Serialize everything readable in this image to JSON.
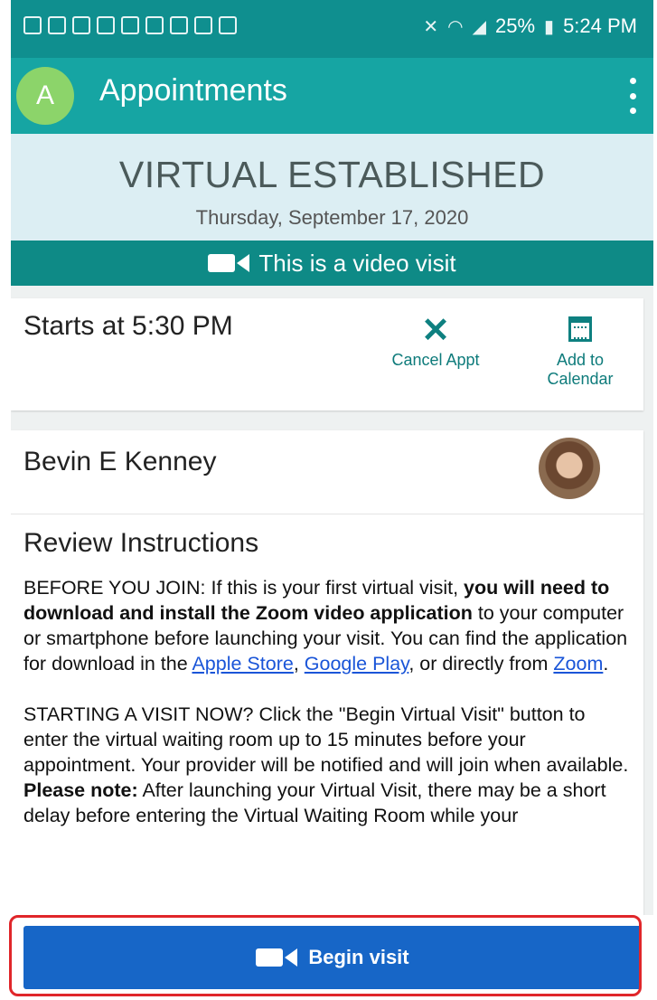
{
  "status_bar": {
    "battery": "25%",
    "time": "5:24 PM"
  },
  "app_bar": {
    "avatar_initial": "A",
    "title": "Appointments",
    "menu_icon": "kebab-menu-icon"
  },
  "visit": {
    "type": "VIRTUAL ESTABLISHED",
    "date": "Thursday, September 17, 2020",
    "video_banner": "This is a video visit"
  },
  "time_card": {
    "starts": "Starts at 5:30 PM",
    "cancel_label": "Cancel Appt",
    "calendar_label_line1": "Add to",
    "calendar_label_line2": "Calendar"
  },
  "provider": {
    "name": "Bevin E Kenney"
  },
  "instructions": {
    "heading": "Review Instructions",
    "p1_start": "BEFORE YOU JOIN: If this is your first virtual visit, ",
    "p1_bold": "you will need to download and install the Zoom video application",
    "p1_mid": " to your computer or smartphone before launching your visit. You can find the application for download in the ",
    "link_apple": "Apple Store",
    "sep1": ", ",
    "link_google": "Google Play",
    "sep2": ", or directly from ",
    "link_zoom": "Zoom",
    "p1_end": ".",
    "p2_start": "STARTING A VISIT NOW? Click the \"Begin Virtual Visit\" button to enter the virtual waiting room up to 15 minutes before your appointment. Your provider will be notified and will join when available. ",
    "p2_bold": "Please note:",
    "p2_end": " After launching your Virtual Visit, there may be a short delay before entering the Virtual Waiting Room while your"
  },
  "begin_button": {
    "label": "Begin visit"
  },
  "colors": {
    "teal_dark": "#0e8a86",
    "teal_appbar": "#16a5a3",
    "button_blue": "#1766c7",
    "highlight_red": "#e0262a"
  }
}
